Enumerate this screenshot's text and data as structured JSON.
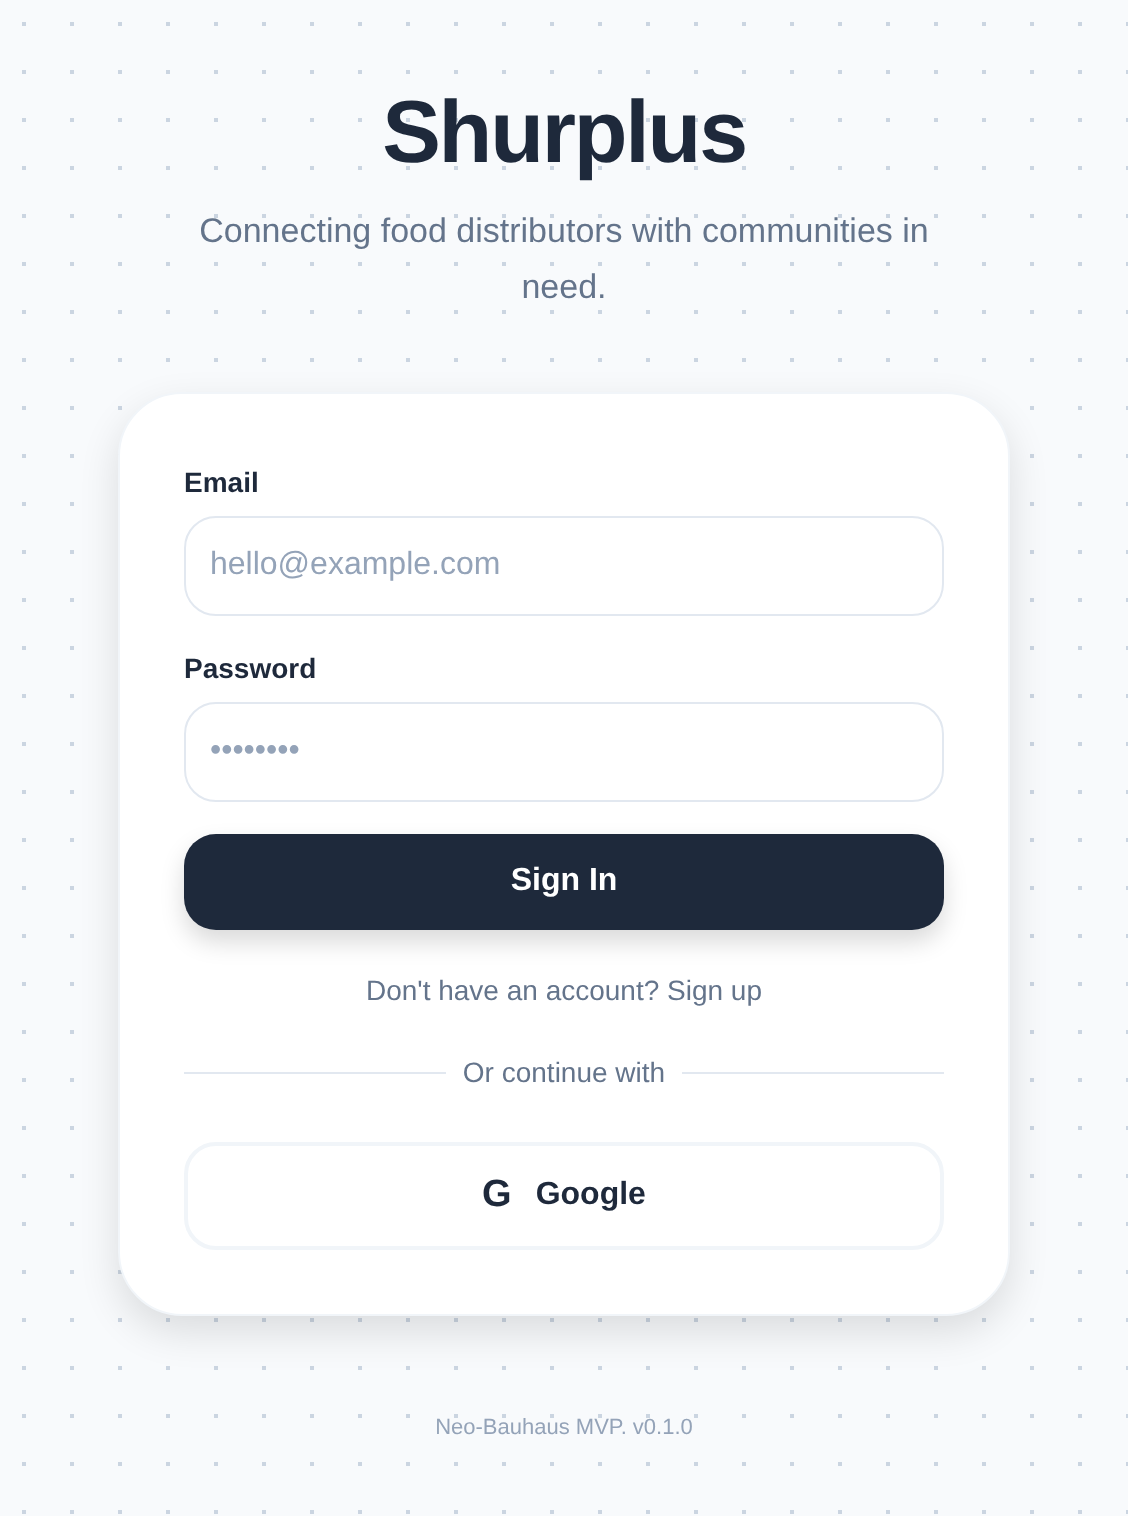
{
  "brand": {
    "title": "Shurplus",
    "tagline": "Connecting food distributors with communities in need."
  },
  "form": {
    "fields": [
      {
        "label": "Email",
        "placeholder": "hello@example.com"
      },
      {
        "label": "Password",
        "placeholder": "••••••••"
      }
    ],
    "submit": "Sign In",
    "signup_prompt": "Don't have an account? Sign up",
    "divider": "Or continue with",
    "social": {
      "icon": "G",
      "label": "Google"
    }
  },
  "footer": "Neo-Bauhaus MVP. v0.1.0"
}
